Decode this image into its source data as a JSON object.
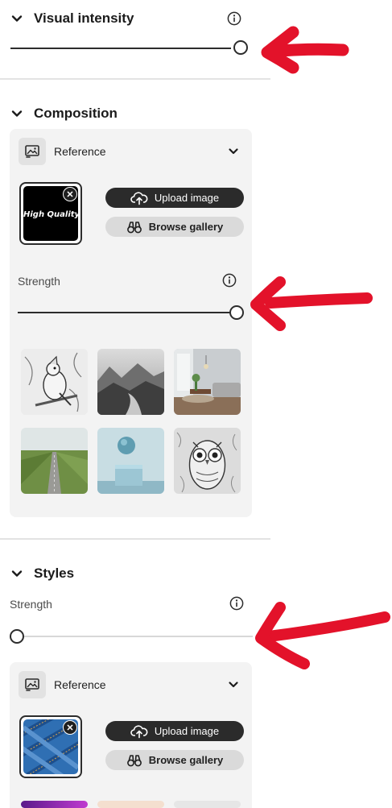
{
  "visual_intensity": {
    "title": "Visual intensity",
    "slider_value": 1.0
  },
  "composition": {
    "title": "Composition",
    "reference_label": "Reference",
    "reference_thumb_text": "High Quality Gor",
    "upload_label": "Upload image",
    "browse_label": "Browse gallery",
    "strength_label": "Strength",
    "strength_value": 1.0,
    "gallery": [
      {
        "name": "bird-sketch"
      },
      {
        "name": "misty-mountains"
      },
      {
        "name": "living-room"
      },
      {
        "name": "field-road"
      },
      {
        "name": "sphere-on-block"
      },
      {
        "name": "owl-sketch"
      }
    ]
  },
  "styles": {
    "title": "Styles",
    "strength_label": "Strength",
    "strength_value": 0.0,
    "reference_label": "Reference",
    "upload_label": "Upload image",
    "browse_label": "Browse gallery"
  },
  "colors": {
    "annotation_arrow": "#e3122a",
    "slider": "#2c2c2c",
    "panel_bg": "#f3f3f3",
    "dark_button": "#2b2b2b"
  },
  "icons": [
    "chevron-down-icon",
    "info-icon",
    "image-reference-icon",
    "upload-cloud-icon",
    "binoculars-icon",
    "close-icon"
  ]
}
